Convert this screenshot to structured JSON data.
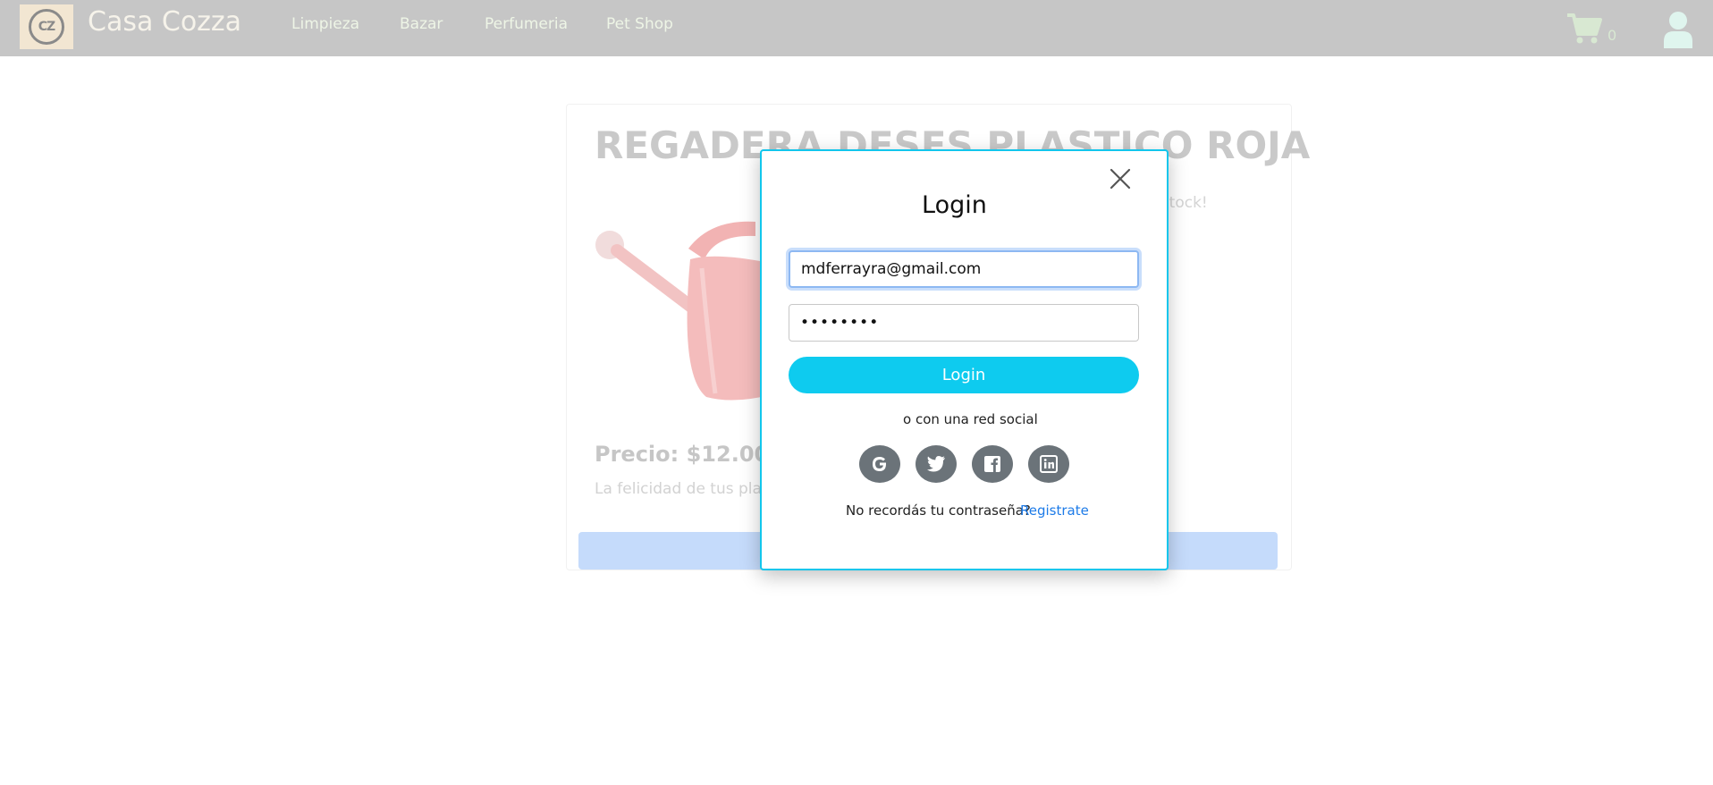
{
  "navbar": {
    "logo_text": "CZ",
    "brand": "Casa Cozza",
    "links": [
      "Limpieza",
      "Bazar",
      "Perfumeria",
      "Pet Shop"
    ],
    "cart_count": "0"
  },
  "product": {
    "title": "REGADERA DESES PLASTICO ROJA",
    "stock_text": "ar stock!",
    "price": "Precio: $12.00",
    "description": "La felicidad de tus plant"
  },
  "login_modal": {
    "title": "Login",
    "email_value": "mdferrayra@gmail.com",
    "password_value": "••••••••",
    "login_button": "Login",
    "social_text": "o con una red social",
    "social_icons": [
      "google-icon",
      "twitter-icon",
      "facebook-icon",
      "linkedin-icon"
    ],
    "forgot_text": "No recordás tu contraseña?",
    "register_link": "Registrate"
  },
  "colors": {
    "accent": "#0ecbef",
    "link": "#1d7be8",
    "navbar_overlay": "#c6c6c6"
  }
}
